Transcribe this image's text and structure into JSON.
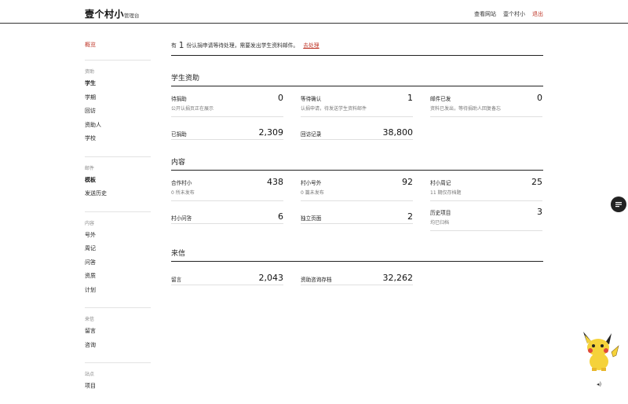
{
  "header": {
    "brand": "壹个村小",
    "brand_sub": "管理台",
    "nav": [
      "查看网站",
      "壹个村小"
    ],
    "logout": "退出"
  },
  "sidebar": {
    "overview": "概览",
    "groups": [
      {
        "title": "资助",
        "items": [
          "学生",
          "学期",
          "回访",
          "资助人",
          "学校"
        ]
      },
      {
        "title": "邮件",
        "items": [
          "模板",
          "发送历史"
        ]
      },
      {
        "title": "内容",
        "items": [
          "号外",
          "周记",
          "问答",
          "资质",
          "计划"
        ]
      },
      {
        "title": "来信",
        "items": [
          "留言",
          "咨询"
        ]
      },
      {
        "title": "站点",
        "items": [
          "项目"
        ]
      }
    ]
  },
  "notice": {
    "prefix": "有",
    "count": "1",
    "text": "份认捐申请等待处理，需要发出学生资料邮件。",
    "action": "去处理"
  },
  "sections": [
    {
      "title": "学生资助",
      "cells": [
        {
          "label": "待捐助",
          "value": "0",
          "desc": "公开认捐页正在展示"
        },
        {
          "label": "等待确认",
          "value": "1",
          "desc": "认捐申请，待发送学生资料邮件"
        },
        {
          "label": "邮件已发",
          "value": "0",
          "desc": "资料已发出，等待捐助人回复备忘"
        },
        {
          "label": "已捐助",
          "value": "2,309",
          "desc": ""
        },
        {
          "label": "回访记录",
          "value": "38,800",
          "desc": ""
        }
      ]
    },
    {
      "title": "内容",
      "cells": [
        {
          "label": "合作村小",
          "value": "438",
          "desc": "0 所未发布"
        },
        {
          "label": "村小号外",
          "value": "92",
          "desc": "0 篇未发布"
        },
        {
          "label": "村小周记",
          "value": "25",
          "desc": "11 期仅存档题"
        },
        {
          "label": "村小问答",
          "value": "6",
          "desc": ""
        },
        {
          "label": "独立页面",
          "value": "2",
          "desc": ""
        },
        {
          "label": "历史项目",
          "value": "3",
          "desc": "均已归档"
        }
      ]
    },
    {
      "title": "来信",
      "cells": [
        {
          "label": "留言",
          "value": "2,043",
          "desc": ""
        },
        {
          "label": "资助咨询存档",
          "value": "32,262",
          "desc": ""
        }
      ]
    }
  ],
  "colors": {
    "accent": "#c0392b",
    "rule": "#222222"
  },
  "icons": {
    "fab": "list-icon",
    "corner": "audio-icon"
  }
}
